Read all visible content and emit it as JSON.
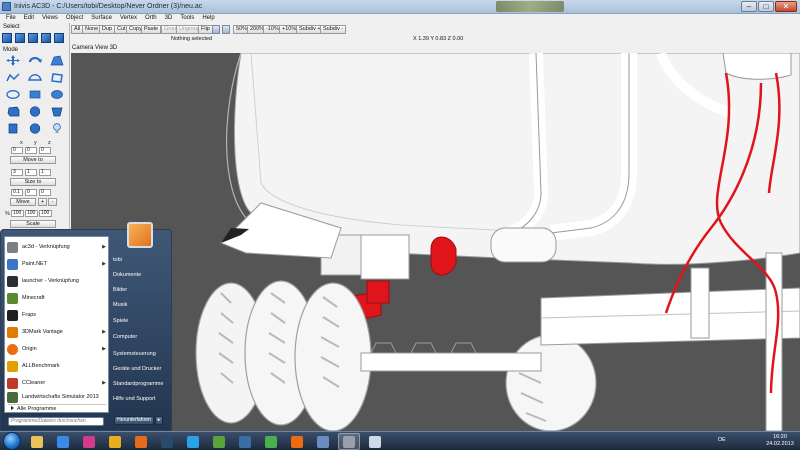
{
  "window": {
    "title": "Inivis AC3D - C:/Users/tobi/Desktop/Never Ordner (3)/neu.ac",
    "controls": [
      "–",
      "□",
      "✕"
    ]
  },
  "menu": [
    "File",
    "Edit",
    "Views",
    "Object",
    "Surface",
    "Vertex",
    "Orth",
    "3D",
    "Tools",
    "Help"
  ],
  "toolbar": {
    "buttons": [
      "All",
      "None",
      "Dup",
      "Cut",
      "Copy",
      "Paste",
      "Group",
      "Ungroup",
      "Flip",
      "50%",
      "200%",
      "-10%",
      "+10%",
      "Subdiv +",
      "Subdiv -"
    ],
    "status": "Nothing selected",
    "coords": "X 1.39 Y 0.83 Z 0.00"
  },
  "left_panel": {
    "select_label": "Select",
    "mode_label": "Mode",
    "axis_labels": [
      "x",
      "y",
      "z"
    ],
    "move": {
      "values": [
        "0",
        "0",
        "0"
      ],
      "button": "Move to"
    },
    "size": {
      "values": [
        "3",
        "1",
        "1"
      ],
      "button": "Size to"
    },
    "offset": {
      "values": [
        "0.1",
        "0",
        "0"
      ],
      "button": "Move",
      "plus": "+",
      "minus": "-"
    },
    "scale": {
      "prefix": "%",
      "values": [
        "100",
        "100",
        "100"
      ],
      "button": "Scale"
    }
  },
  "viewport": {
    "label": "Camera View 3D",
    "colors": {
      "background": "#555555",
      "model": "#ffffff",
      "highlight": "#e0141b"
    }
  },
  "start_menu": {
    "programs": [
      {
        "label": "ac3d - Verknüpfung",
        "icon": "ac3d-icon",
        "color": "#7c7f86",
        "submenu": true
      },
      {
        "label": "Paint.NET",
        "icon": "paintnet-icon",
        "color": "#3b76c9",
        "submenu": true
      },
      {
        "label": "launcher - Verknüpfung",
        "icon": "fcs-launcher-icon",
        "color": "#2a2f36",
        "submenu": false
      },
      {
        "label": "Minecraft",
        "icon": "minecraft-icon",
        "color": "#5a8a2f",
        "submenu": false
      },
      {
        "label": "Fraps",
        "icon": "fraps-icon",
        "color": "#1f1f1f",
        "submenu": false
      },
      {
        "label": "3DMark Vantage",
        "icon": "3dmark-icon",
        "color": "#e07b00",
        "submenu": true
      },
      {
        "label": "Origin",
        "icon": "origin-icon",
        "color": "#f06a12",
        "submenu": true
      },
      {
        "label": "ALLBenchmark",
        "icon": "allbenchmark-icon",
        "color": "#e0a100",
        "submenu": false
      },
      {
        "label": "CCleaner",
        "icon": "ccleaner-icon",
        "color": "#c23a2c",
        "submenu": true
      },
      {
        "label": "Landwirtschafts Simulator 2013",
        "icon": "farming-simulator-icon",
        "color": "#4a6a3a",
        "submenu": false
      }
    ],
    "all_programs": "Alle Programme",
    "search_placeholder": "Programme/Dateien durchsuchen",
    "right_items": [
      "tobi",
      "Dokumente",
      "Bilder",
      "Musik",
      "Spiele",
      "Computer",
      "Systemsteuerung",
      "Geräte und Drucker",
      "Standardprogramme",
      "Hilfe und Support"
    ],
    "shutdown": "Herunterfahren"
  },
  "taskbar": {
    "apps": [
      {
        "icon": "explorer-folder-icon",
        "color": "#e9c25a"
      },
      {
        "icon": "media-player-icon",
        "color": "#3a8be6"
      },
      {
        "icon": "itunes-icon",
        "color": "#d03b8a"
      },
      {
        "icon": "chrome-icon",
        "color": "#e8b021"
      },
      {
        "icon": "firefox-icon",
        "color": "#e56a1c"
      },
      {
        "icon": "steam-icon",
        "color": "#2b4a6a"
      },
      {
        "icon": "skype-icon",
        "color": "#2aa3e6"
      },
      {
        "icon": "utorrent-icon",
        "color": "#5aa33a"
      },
      {
        "icon": "teamspeak-icon",
        "color": "#3b6ea6"
      },
      {
        "icon": "green-app-icon",
        "color": "#4bb04b"
      },
      {
        "icon": "origin-icon",
        "color": "#f06a12"
      },
      {
        "icon": "paint-icon",
        "color": "#6b8cc4"
      },
      {
        "icon": "ac3d-icon",
        "color": "#9aa0a8"
      },
      {
        "icon": "document-app-icon",
        "color": "#cfd8e6"
      }
    ],
    "active_index": 12,
    "language": "DE",
    "time": "16:20",
    "date": "24.02.2013"
  }
}
